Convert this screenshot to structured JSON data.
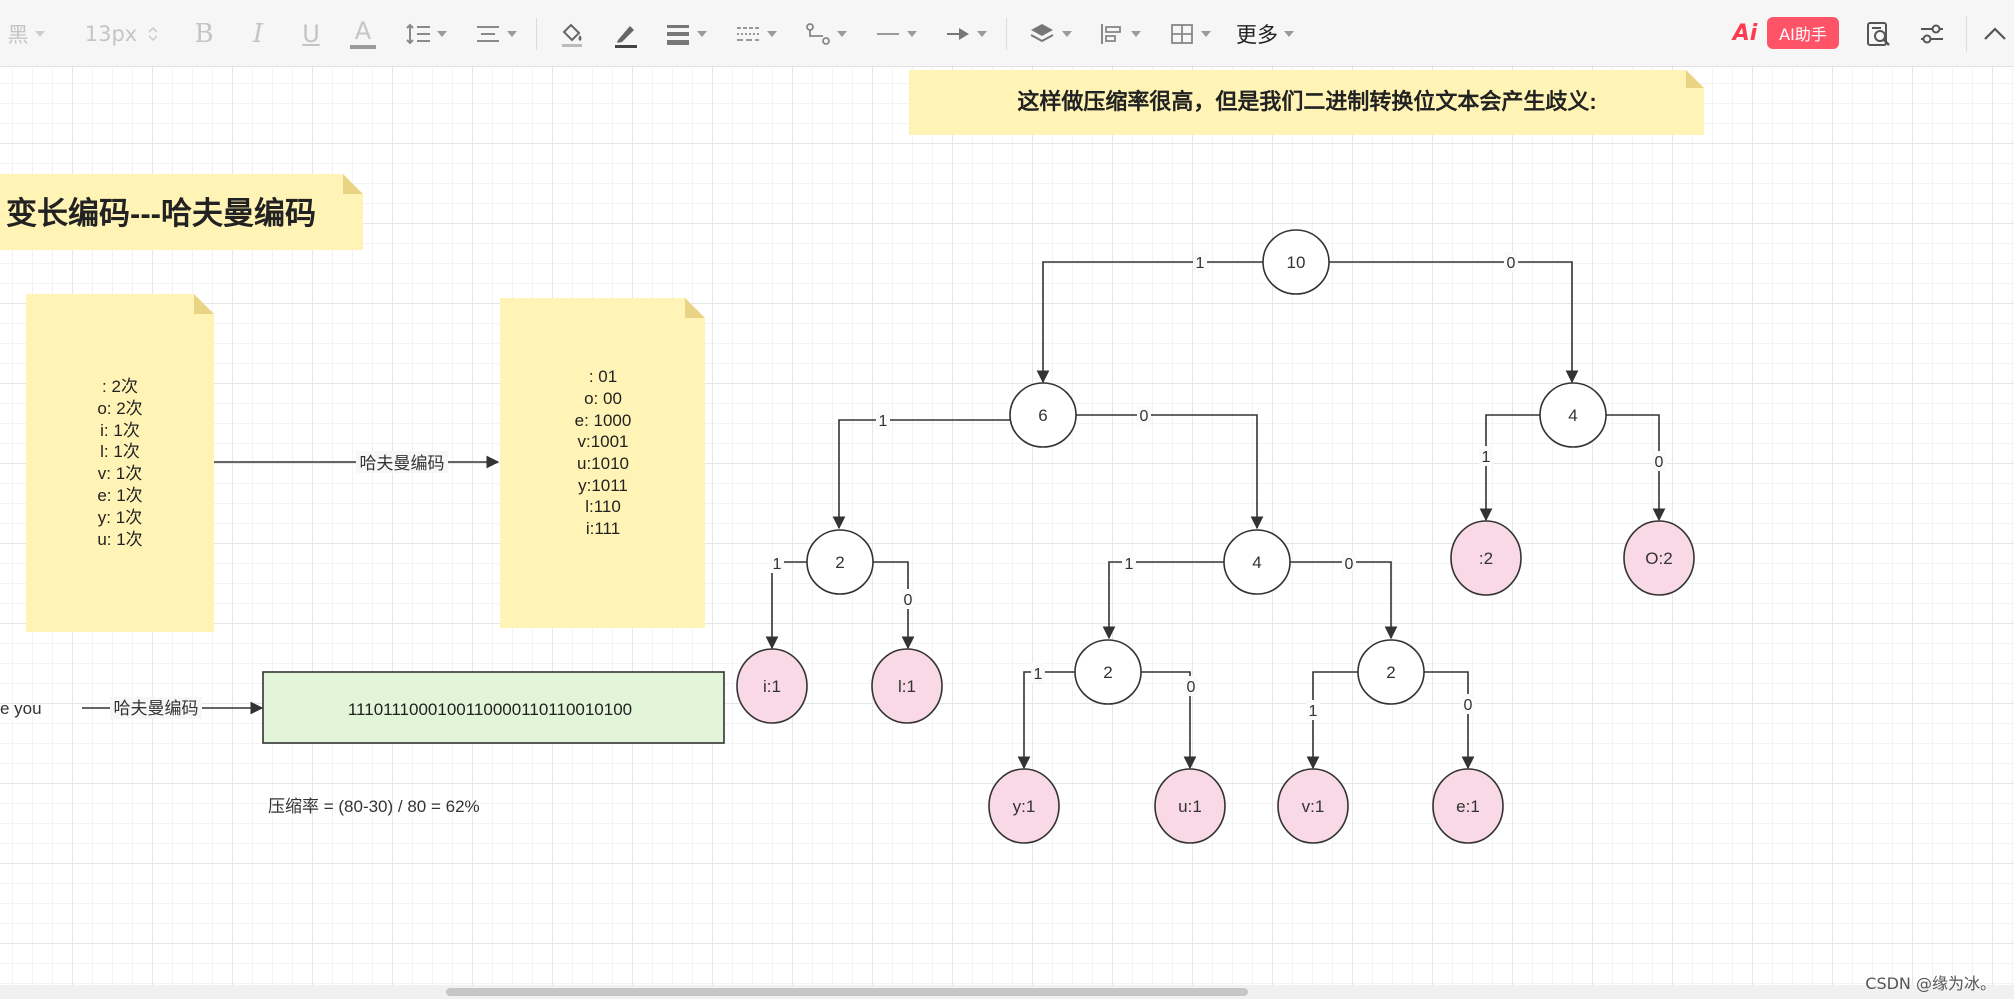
{
  "toolbar": {
    "font_name": "黑",
    "font_size": "13px",
    "bold_label": "B",
    "italic_label": "I",
    "underline_label": "U",
    "font_color_label": "A",
    "more_label": "更多",
    "ai_logo": "Ai",
    "ai_assistant_label": "AI助手",
    "icons": [
      "font-color-icon",
      "line-height-icon",
      "align-icon",
      "fill-icon",
      "line-color-icon",
      "line-width-icon",
      "line-style-icon",
      "connector-icon",
      "line-end-icon",
      "arrow-icon",
      "layer-icon",
      "align-left-icon",
      "distribute-icon",
      "find-icon",
      "settings-icon",
      "collapse-icon"
    ],
    "ai_color": "#ff5468"
  },
  "notes": {
    "banner": "这样做压缩率很高，但是我们二进制转换位文本会产生歧义:",
    "title": "变长编码---哈夫曼编码",
    "frequency_lines": [
      ":  2次",
      "o: 2次",
      "i: 1次",
      "l: 1次",
      "v: 1次",
      "e: 1次",
      "y: 1次",
      "u: 1次"
    ],
    "code_lines": [
      ": 01",
      "o: 00",
      "e: 1000",
      "v:1001",
      "u:1010",
      "y:1011",
      "l:110",
      "i:111"
    ],
    "note_color": "#fff4b5"
  },
  "flow": {
    "arrow1_label": "哈夫曼编码",
    "arrow2_label": "哈夫曼编码",
    "source_text": "e you",
    "encoded_bits": "1110111000100110000110110010100",
    "compression_rate": "压缩率 =  (80-30) / 80 = 62%",
    "box_color": "#e2f5d8"
  },
  "tree": {
    "nodes": {
      "root": "10",
      "n6": "6",
      "n4r": "4",
      "n2a": "2",
      "n4m": "4",
      "n2b": "2",
      "n2c": "2",
      "leaf_i": "i:1",
      "leaf_l": "l:1",
      "leaf_colon": ":2",
      "leaf_o": "O:2",
      "leaf_y": "y:1",
      "leaf_u": "u:1",
      "leaf_v": "v:1",
      "leaf_e": "e:1"
    },
    "edge_labels": {
      "root_left": "1",
      "root_right": "0",
      "n6_left": "1",
      "n6_right": "0",
      "n4r_left": "1",
      "n4r_right": "0",
      "n2a_left": "1",
      "n2a_right": "0",
      "n4m_left": "1",
      "n4m_right": "0",
      "n2b_left": "1",
      "n2b_right": "0",
      "n2c_left": "1",
      "n2c_right": "0"
    },
    "leaf_color": "#f9d9e6"
  },
  "watermark": "CSDN @缘为冰。"
}
